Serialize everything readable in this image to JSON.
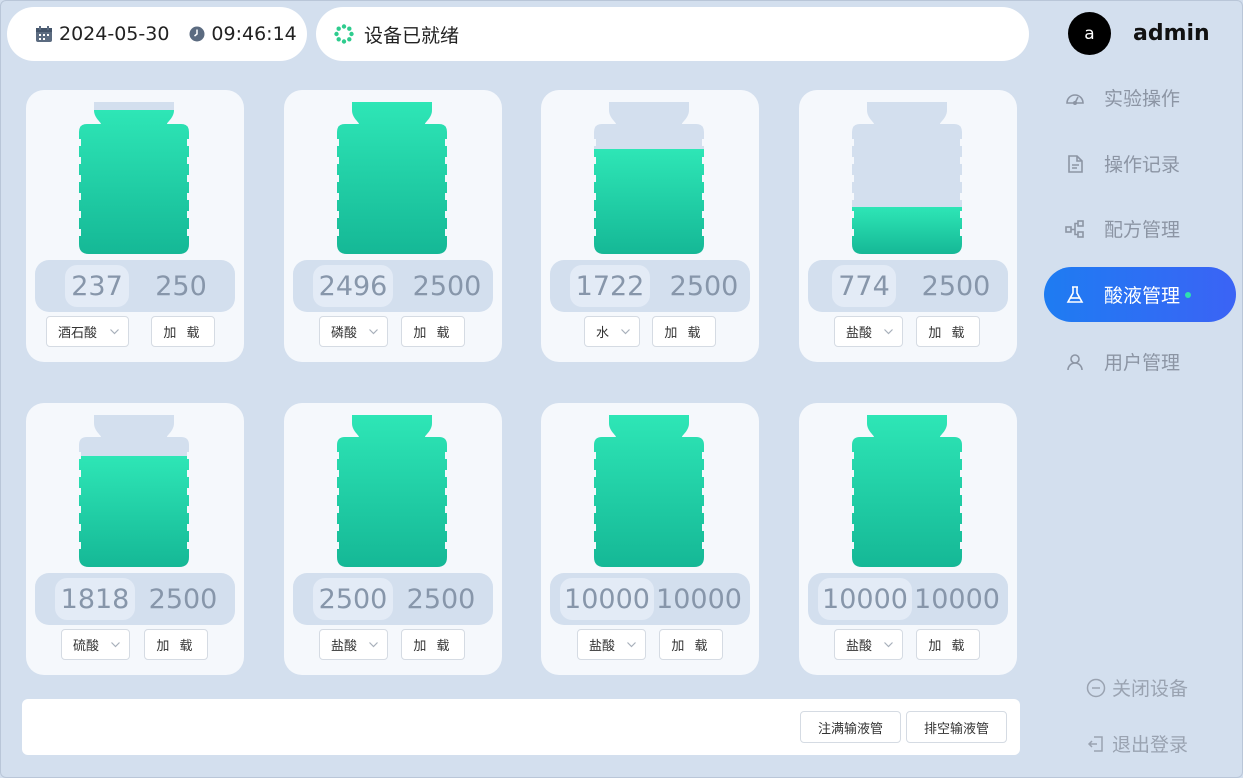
{
  "header": {
    "date": "2024-05-30",
    "time": "09:46:14",
    "status": "设备已就绪"
  },
  "user": {
    "initial": "a",
    "name": "admin"
  },
  "nav": [
    {
      "label": "实验操作",
      "icon": "dashboard-icon",
      "active": false
    },
    {
      "label": "操作记录",
      "icon": "document-icon",
      "active": false
    },
    {
      "label": "配方管理",
      "icon": "flow-icon",
      "active": false
    },
    {
      "label": "酸液管理",
      "icon": "flask-icon",
      "active": true
    },
    {
      "label": "用户管理",
      "icon": "user-icon",
      "active": false
    }
  ],
  "footer_actions": {
    "shutdown": "关闭设备",
    "logout": "退出登录"
  },
  "bottles": [
    {
      "current": "237",
      "capacity": "250",
      "fill": 0.948,
      "acid": "酒石酸",
      "load": "加 载"
    },
    {
      "current": "2496",
      "capacity": "2500",
      "fill": 0.998,
      "acid": "磷酸",
      "load": "加 载"
    },
    {
      "current": "1722",
      "capacity": "2500",
      "fill": 0.689,
      "acid": "水",
      "load": "加 载"
    },
    {
      "current": "774",
      "capacity": "2500",
      "fill": 0.31,
      "acid": "盐酸",
      "load": "加 载"
    },
    {
      "current": "1818",
      "capacity": "2500",
      "fill": 0.727,
      "acid": "硫酸",
      "load": "加 载"
    },
    {
      "current": "2500",
      "capacity": "2500",
      "fill": 1.0,
      "acid": "盐酸",
      "load": "加 载"
    },
    {
      "current": "10000",
      "capacity": "10000",
      "fill": 1.0,
      "acid": "盐酸",
      "load": "加 载"
    },
    {
      "current": "10000",
      "capacity": "10000",
      "fill": 1.0,
      "acid": "盐酸",
      "load": "加 载"
    }
  ],
  "bottom_bar": {
    "fill_tube": "注满输液管",
    "drain_tube": "排空输液管"
  },
  "colors": {
    "accent": "#1e7cf2",
    "liquid_top": "#2ee6b6",
    "liquid_bottom": "#15b896",
    "empty": "#d3dfee"
  }
}
